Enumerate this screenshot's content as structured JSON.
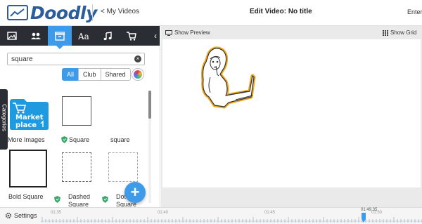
{
  "header": {
    "logo_text": "Doodly",
    "back_label": "< My Videos",
    "title": "Edit Video: No title",
    "right_menu": "Enterp"
  },
  "library": {
    "tabs": [
      {
        "icon": "image-icon",
        "active": false
      },
      {
        "icon": "people-icon",
        "active": false
      },
      {
        "icon": "props-icon",
        "active": true
      },
      {
        "icon": "text-icon",
        "active": false
      },
      {
        "icon": "music-icon",
        "active": false
      },
      {
        "icon": "cart-icon",
        "active": false
      }
    ],
    "collapse_glyph": "‹",
    "search_value": "square",
    "filters": [
      "All",
      "Club",
      "Shared"
    ],
    "active_filter": "All",
    "categories_label": "Categories",
    "marketplace_line1": "Market",
    "marketplace_line2": "place",
    "items": [
      {
        "caption": "More Images"
      },
      {
        "caption": "Square"
      },
      {
        "caption": "square"
      },
      {
        "caption": "Bold Square"
      },
      {
        "caption": "Dashed Square"
      },
      {
        "caption": "Dotted Square"
      }
    ],
    "add_glyph": "+"
  },
  "stage": {
    "show_preview": "Show Preview",
    "show_grid": "Show Grid"
  },
  "timeline": {
    "settings_label": "Settings",
    "ticks": [
      "01:35",
      "01:40",
      "01:45",
      "01:50"
    ],
    "playhead_time": "01:49.35"
  },
  "colors": {
    "accent": "#3d9be9",
    "toolbar": "#2a2d33",
    "logo": "#2b5d9b",
    "highlight_outline": "#f0a91c"
  }
}
